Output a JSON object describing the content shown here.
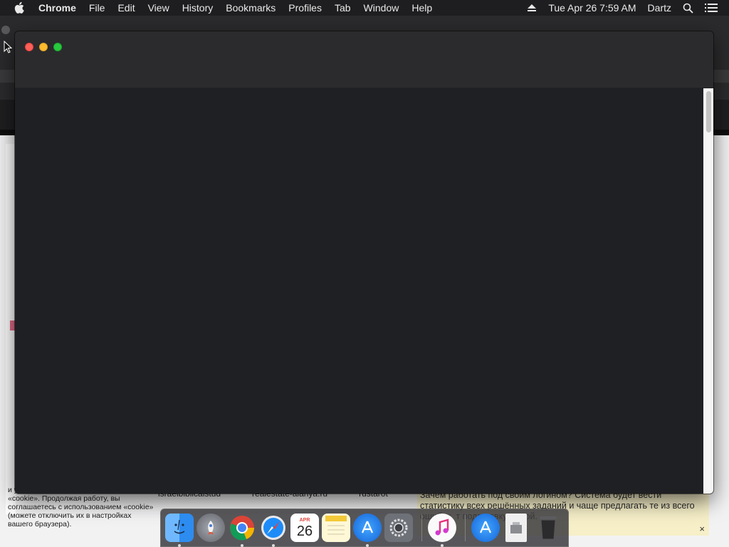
{
  "menubar": {
    "apple_icon": "apple-icon",
    "app_name": "Chrome",
    "items": [
      "File",
      "Edit",
      "View",
      "History",
      "Bookmarks",
      "Profiles",
      "Tab",
      "Window",
      "Help"
    ],
    "clock": "Tue Apr 26  7:59 AM",
    "user": "Dartz",
    "icons": [
      "eject-icon",
      "search-icon",
      "list-icon"
    ]
  },
  "background_page": {
    "cookie_notice": "и удобства работы используются файлы «cookie». Продолжая работу, вы соглашаетесь с использованием «cookie» (можете отключить их в настройках вашего браузера).",
    "bookmarks": [
      "israelbiblicalstud",
      "realestate-alanya.ru",
      "rustarot"
    ],
    "banner_text": "Зачем работать под своим логином? Система будет вести статистику всех решённых заданий и чаще предлагать те из всего ошибок. т подготовку умной.",
    "banner_close": "×"
  },
  "window": {
    "buttons": [
      "close",
      "minimize",
      "maximize"
    ]
  },
  "dock": {
    "apps": [
      {
        "name": "finder",
        "running": true,
        "color": "#2d8cf0"
      },
      {
        "name": "launchpad",
        "running": false,
        "color": "#8a8d93"
      },
      {
        "name": "chrome",
        "running": true,
        "color": "#ffffff"
      },
      {
        "name": "safari",
        "running": true,
        "color": "#1d8cf8"
      },
      {
        "name": "calendar",
        "running": false,
        "color": "#ffffff",
        "label_month": "APR",
        "label_day": "26"
      },
      {
        "name": "notes",
        "running": false,
        "color": "#fbe27a"
      },
      {
        "name": "app-store",
        "running": true,
        "color": "#1a8cf5"
      },
      {
        "name": "system-preferences",
        "running": false,
        "color": "#7c7f86"
      },
      {
        "name": "itunes",
        "running": true,
        "color": "#f5f5f5"
      },
      {
        "name": "app-store-folder",
        "running": false,
        "color": "#1a8cf5"
      },
      {
        "name": "preview-document",
        "running": false,
        "color": "#e9e9e9"
      },
      {
        "name": "trash",
        "running": false,
        "color": "#3c3c3e"
      }
    ]
  }
}
